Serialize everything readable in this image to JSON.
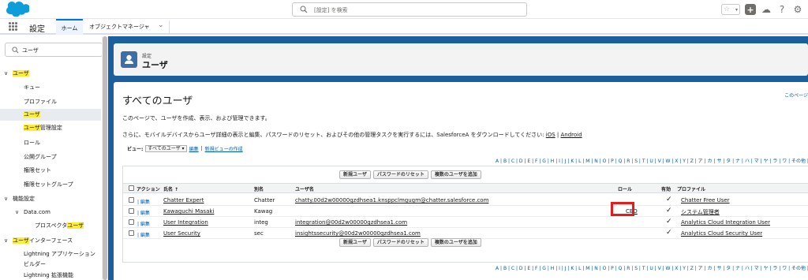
{
  "header": {
    "search_placeholder": "[設定] を検索"
  },
  "nav": {
    "app_name": "設定",
    "tab_home": "ホーム",
    "tab_object_manager": "オブジェクトマネージャ"
  },
  "sidebar": {
    "search_value": "ユーザ",
    "items": [
      {
        "label_hl": "ユーザ",
        "label_rest": "",
        "level": 0,
        "chevron": "∨"
      },
      {
        "label_hl": "",
        "label_rest": "キュー",
        "level": 1
      },
      {
        "label_hl": "",
        "label_rest": "プロファイル",
        "level": 1
      },
      {
        "label_hl": "ユーザ",
        "label_rest": "",
        "level": 1,
        "selected": true
      },
      {
        "label_hl": "ユーザ",
        "label_rest": "管理設定",
        "level": 1
      },
      {
        "label_hl": "",
        "label_rest": "ロール",
        "level": 1
      },
      {
        "label_hl": "",
        "label_rest": "公開グループ",
        "level": 1
      },
      {
        "label_hl": "",
        "label_rest": "権限セット",
        "level": 1
      },
      {
        "label_hl": "",
        "label_rest": "権限セットグループ",
        "level": 1
      },
      {
        "label_hl": "",
        "label_rest": "機能設定",
        "level": 0,
        "chevron": "∨"
      },
      {
        "label_hl": "",
        "label_rest": "Data.com",
        "level": 1,
        "chevron": "∨"
      },
      {
        "label_pre": "プロスペクタ",
        "label_hl": "ユーザ",
        "label_rest": "",
        "level": 2
      },
      {
        "label_hl": "ユーザ",
        "label_rest": "インターフェース",
        "level": 0,
        "chevron": "∨"
      },
      {
        "label_hl": "",
        "label_rest": "Lightning アプリケーションビルダー",
        "level": 1
      },
      {
        "label_hl": "",
        "label_rest": "Lightning 拡張機能",
        "level": 1
      }
    ]
  },
  "page_header": {
    "breadcrumb": "設定",
    "title": "ユーザ"
  },
  "content": {
    "title": "すべてのユーザ",
    "help_link": "このページ",
    "description": "このページで、ユーザを作成、表示、および管理できます。",
    "mobile_text": "さらに、モバイルデバイスからユーザ詳細の表示と編集、パスワードのリセット、およびその他の管理タスクを実行するには、SalesforceA をダウンロードしてください:",
    "ios_link": "iOS",
    "separator": "|",
    "android_link": "Android",
    "view_label": "ビュー:",
    "view_value": "すべてのユーザ",
    "edit_view": "編集",
    "create_view": "新規ビューの作成",
    "alphabet": "A | B | C | D | E | F | G | H | I | J | K | L | M | N | O | P | Q | R | S | T | U | V | W | X | Y | Z | ア | カ | サ | タ | ナ | ハ | マ | ヤ | ラ | ワ | その他 |"
  },
  "buttons": {
    "new_user": "新規ユーザ",
    "reset_password": "パスワードのリセット",
    "add_multiple": "複数のユーザを追加"
  },
  "table": {
    "headers": {
      "action": "アクション",
      "name": "氏名 ↑",
      "alias": "別名",
      "username": "ユーザ名",
      "role": "ロール",
      "active": "有効",
      "profile": "プロファイル"
    },
    "edit_label": "編集",
    "rows": [
      {
        "name": "Chatter Expert",
        "alias": "Chatter",
        "username": "chatty.00d2w00000gzdhsea1.knsppclmgugm@chatter.salesforce.com",
        "role": "",
        "active": "✓",
        "profile": "Chatter Free User"
      },
      {
        "name": "Kawaguchi Masaki",
        "alias": "Kawag",
        "username": "",
        "role": "CEO",
        "active": "✓",
        "profile": "システム管理者"
      },
      {
        "name": "User Integration",
        "alias": "integ",
        "username": "integration@00d2w00000gzdhsea1.com",
        "role": "",
        "active": "✓",
        "profile": "Analytics Cloud Integration User"
      },
      {
        "name": "User Security",
        "alias": "sec",
        "username": "insightssecurity@00d2w00000gzdhsea1.com",
        "role": "",
        "active": "✓",
        "profile": "Analytics Cloud Security User"
      }
    ]
  },
  "colors": {
    "brand_blue": "#1b5f9e",
    "highlight": "#fcec3a",
    "annotation_red": "#e41c1c"
  }
}
